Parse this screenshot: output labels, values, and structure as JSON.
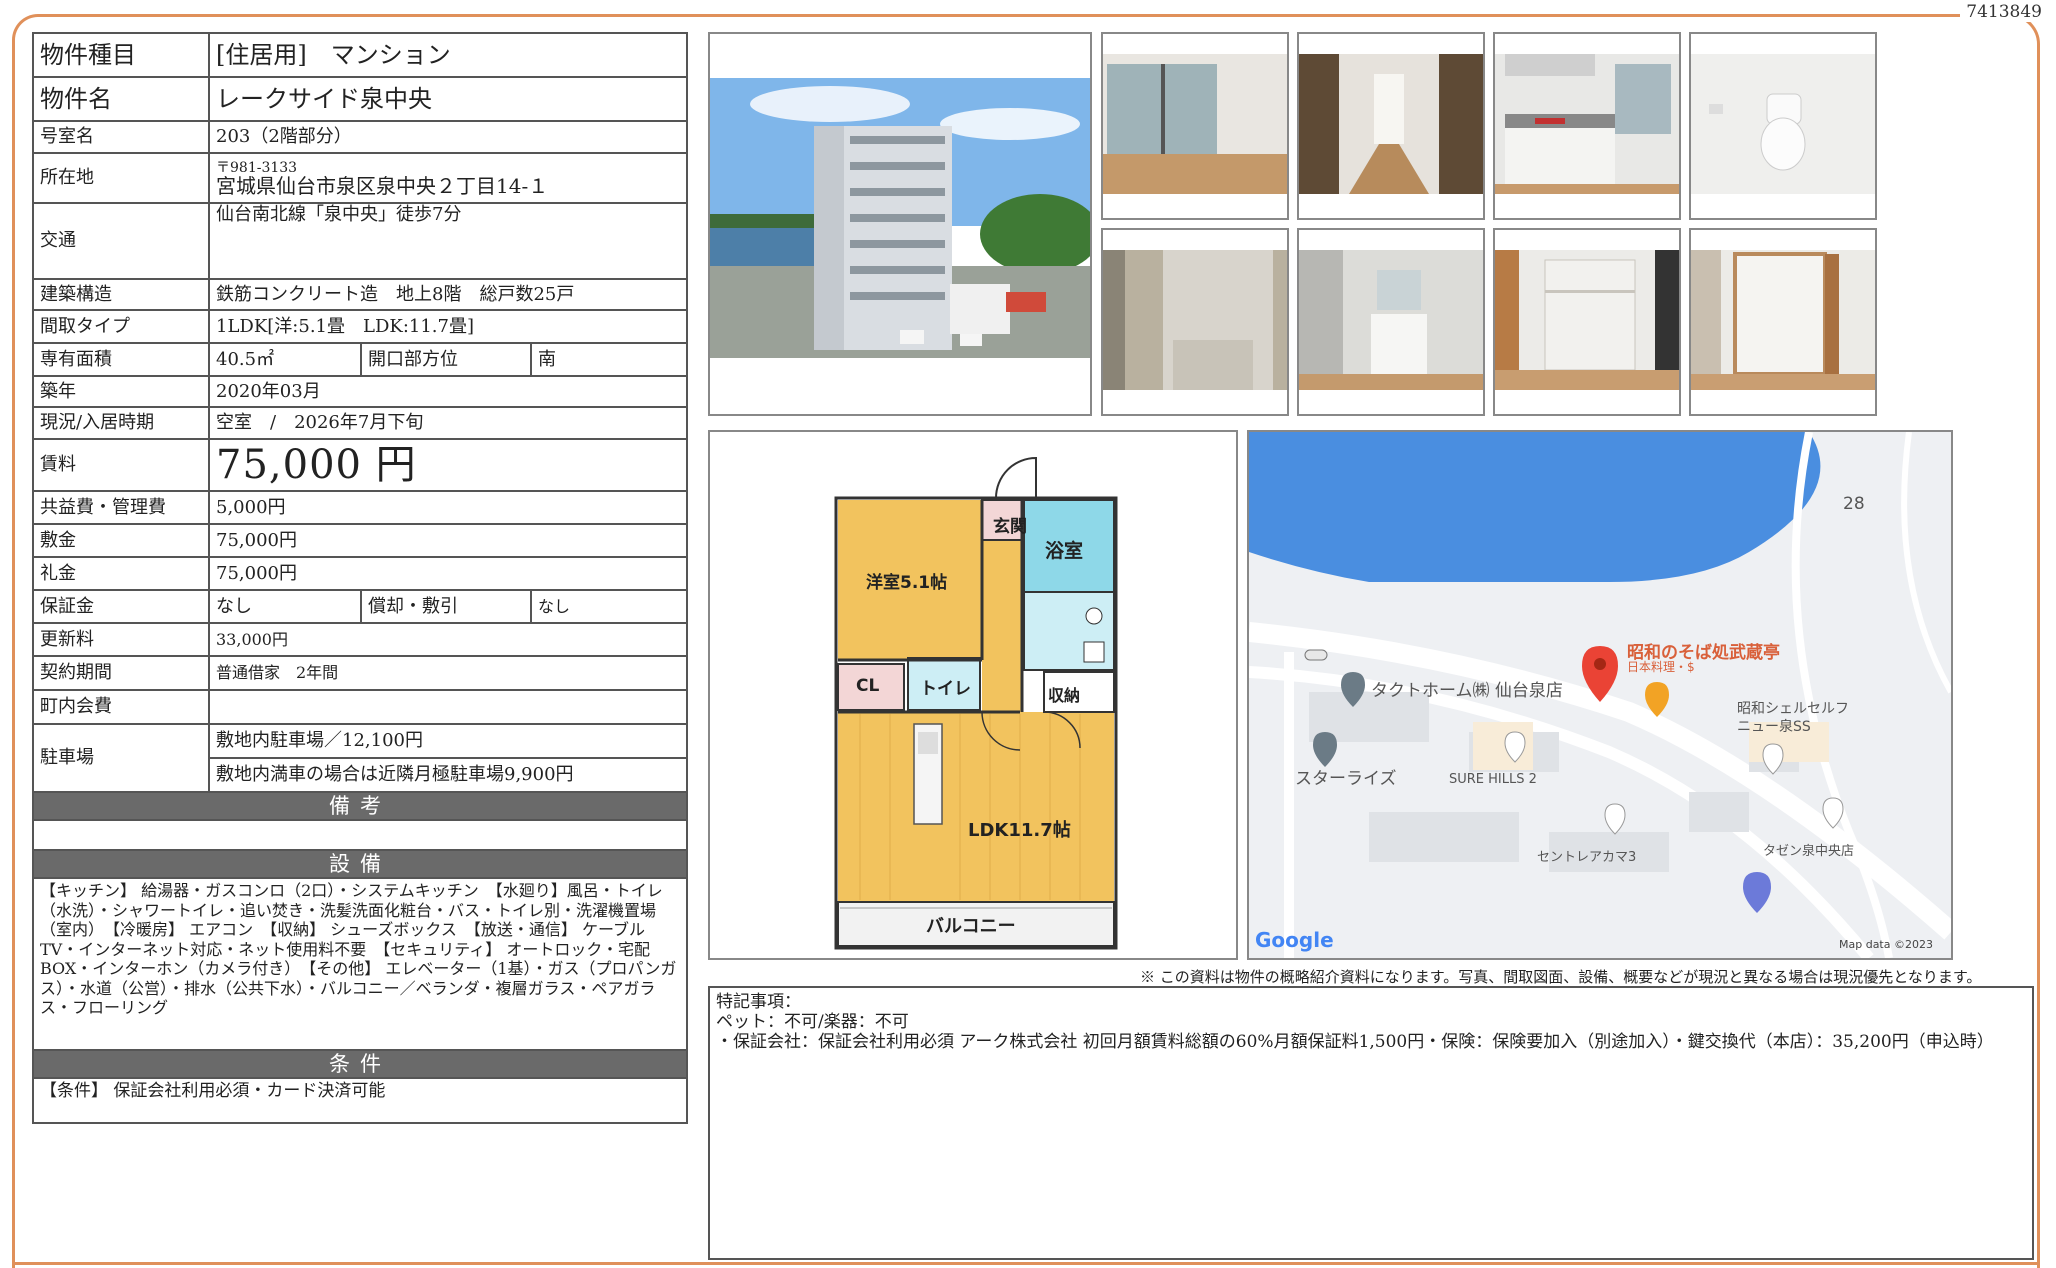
{
  "doc_id": "7413849",
  "property": {
    "type_label": "物件種目",
    "type_value": "[住居用]　マンション",
    "name_label": "物件名",
    "name_value": "レークサイド泉中央",
    "room_label": "号室名",
    "room_value": "203（2階部分）",
    "address_label": "所在地",
    "postal": "〒981-3133",
    "address": "宮城県仙台市泉区泉中央２丁目14-１",
    "access_label": "交通",
    "access_value": "仙台南北線「泉中央」徒歩7分",
    "structure_label": "建築構造",
    "structure_value": "鉄筋コンクリート造　地上8階　総戸数25戸",
    "layout_label": "間取タイプ",
    "layout_value": "1LDK[洋:5.1畳　LDK:11.7畳]",
    "area_label": "専有面積",
    "area_value": "40.5㎡",
    "direction_label": "開口部方位",
    "direction_value": "南",
    "built_label": "築年",
    "built_value": "2020年03月",
    "status_label": "現況/入居時期",
    "status_value": "空室　/　2026年7月下旬",
    "rent_label": "賃料",
    "rent_value": "75,000 円",
    "fee_label": "共益費・管理費",
    "fee_value": "5,000円",
    "deposit_label": "敷金",
    "deposit_value": "75,000円",
    "key_money_label": "礼金",
    "key_money_value": "75,000円",
    "guarantee_label": "保証金",
    "guarantee_value": "なし",
    "amort_label": "償却・敷引",
    "amort_value": "なし",
    "renewal_label": "更新料",
    "renewal_value": "33,000円",
    "contract_label": "契約期間",
    "contract_value": "普通借家　2年間",
    "town_fee_label": "町内会費",
    "town_fee_value": "",
    "parking_label": "駐車場",
    "parking_value1": "敷地内駐車場／12,100円",
    "parking_value2": "敷地内満車の場合は近隣月極駐車場9,900円"
  },
  "sections": {
    "notes_title": "備考",
    "notes_value": "",
    "equipment_title": "設備",
    "equipment_text": "【キッチン】 給湯器・ガスコンロ（2口）・システムキッチン　【水廻り】風呂・トイレ（水洗）・シャワートイレ・追い焚き・洗髪洗面化粧台・バス・トイレ別・洗濯機置場（室内）　【冷暖房】 エアコン　【収納】 シューズボックス　【放送・通信】 ケーブルTV・インターネット対応・ネット使用料不要　【セキュリティ】 オートロック・宅配BOX・インターホン（カメラ付き）　【その他】 エレベーター（1基）・ガス（プロパンガス）・水道（公営）・排水（公共下水）・バルコニー／ベランダ・複層ガラス・ペアガラス・フローリング",
    "conditions_title": "条件",
    "conditions_text": "【条件】 保証会社利用必須・カード決済可能"
  },
  "floorplan": {
    "entrance": "玄関",
    "bath": "浴室",
    "western_room": "洋室5.1帖",
    "closet": "CL",
    "toilet": "トイレ",
    "storage": "収納",
    "ldk": "LDK11.7帖",
    "balcony": "バルコニー"
  },
  "map": {
    "poi_restaurant": "昭和のそば処武蔵亭",
    "poi_restaurant_sub": "日本料理・$",
    "poi_tact": "タクトホーム㈱ 仙台泉店",
    "poi_shell": "昭和シェルセルフ",
    "poi_shell2": "ニュー泉SS",
    "poi_starrise": "スターライズ",
    "poi_surehills": "SURE HILLS 2",
    "poi_central": "セントレアカマ3",
    "poi_tazen": "タゼン泉中央店",
    "road_number": "28",
    "google": "Google",
    "map_data": "Map data ©2023"
  },
  "disclaimer": "※ この資料は物件の概略紹介資料になります。写真、間取図面、設備、概要などが現況と異なる場合は現況優先となります。",
  "special": {
    "title": "特記事項：",
    "line1": "ペット：不可/楽器：不可",
    "line2": "・保証会社：保証会社利用必須 アーク株式会社 初回月額賃料総額の60%月額保証料1,500円・保険：保険要加入（別途加入）・鍵交換代（本店）：35,200円（申込時）"
  },
  "colors": {
    "frame": "#e0905a",
    "section_header": "#6a6a6a",
    "floor": "#f2c35e",
    "water": "#4a8ee0"
  }
}
